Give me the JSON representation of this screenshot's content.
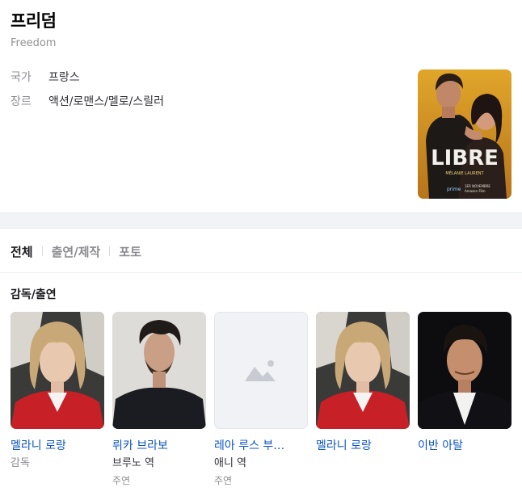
{
  "movie": {
    "title": "프리덤",
    "original_title": "Freedom",
    "country_label": "국가",
    "country": "프랑스",
    "genre_label": "장르",
    "genre": "액션/로맨스/멜로/스릴러",
    "poster_text": "LIBRE",
    "poster_credit": "MÉLANIE LAURENT",
    "poster_brand": "prime",
    "poster_date": "1ER NOVEMBRE",
    "poster_studio": "Amazon Film"
  },
  "tabs": [
    {
      "label": "전체",
      "active": true
    },
    {
      "label": "출연/제작",
      "active": false
    },
    {
      "label": "포토",
      "active": false
    }
  ],
  "cast_section": {
    "title": "감독/출연",
    "people": [
      {
        "name": "멜라니 로랑",
        "role": "감독",
        "kind": ""
      },
      {
        "name": "뤼카 브라보",
        "role": "브루노 역",
        "kind": "주연"
      },
      {
        "name": "레아 루스 부…",
        "role": "애니 역",
        "kind": "주연"
      },
      {
        "name": "멜라니 로랑",
        "role": "",
        "kind": ""
      },
      {
        "name": "이반 아탈",
        "role": "",
        "kind": ""
      }
    ]
  },
  "colors": {
    "link": "#0b55c4",
    "muted": "#8e8e92",
    "band": "#f1f3f7"
  }
}
